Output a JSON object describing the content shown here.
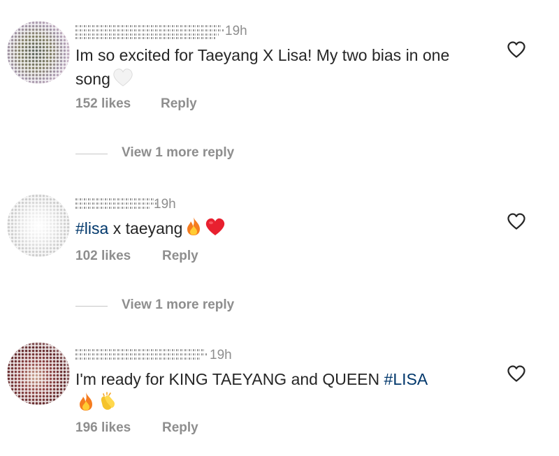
{
  "comments": [
    {
      "timestamp": "19h",
      "text": "Im so excited for Taeyang X Lisa! My two bias in one song",
      "emoji": [
        "white-heart"
      ],
      "likes_label": "152 likes",
      "reply_label": "Reply",
      "view_more_label": "View 1 more reply",
      "avatar_colors": [
        "#8a8a6a",
        "#5e6b72",
        "#c9a7b9"
      ]
    },
    {
      "timestamp": "19h",
      "hashtag": "#lisa",
      "text": " x taeyang",
      "emoji": [
        "fire",
        "red-heart"
      ],
      "likes_label": "102 likes",
      "reply_label": "Reply",
      "view_more_label": "View 1 more reply",
      "avatar_colors": [
        "#d9d9d9",
        "#bfbfbf",
        "#eeeeee"
      ]
    },
    {
      "timestamp": "19h",
      "text_line1": "I'm ready for KING TAEYANG and QUEEN ",
      "hashtag": "#LISA",
      "emoji": [
        "fire",
        "clapping-hands"
      ],
      "likes_label": "196 likes",
      "reply_label": "Reply",
      "avatar_colors": [
        "#7a2e2e",
        "#4a1a1a",
        "#a05050"
      ]
    }
  ],
  "colors": {
    "text": "#262626",
    "secondary": "#8e8e8e",
    "hashtag": "#00376b",
    "divider": "#c7c7c7"
  }
}
